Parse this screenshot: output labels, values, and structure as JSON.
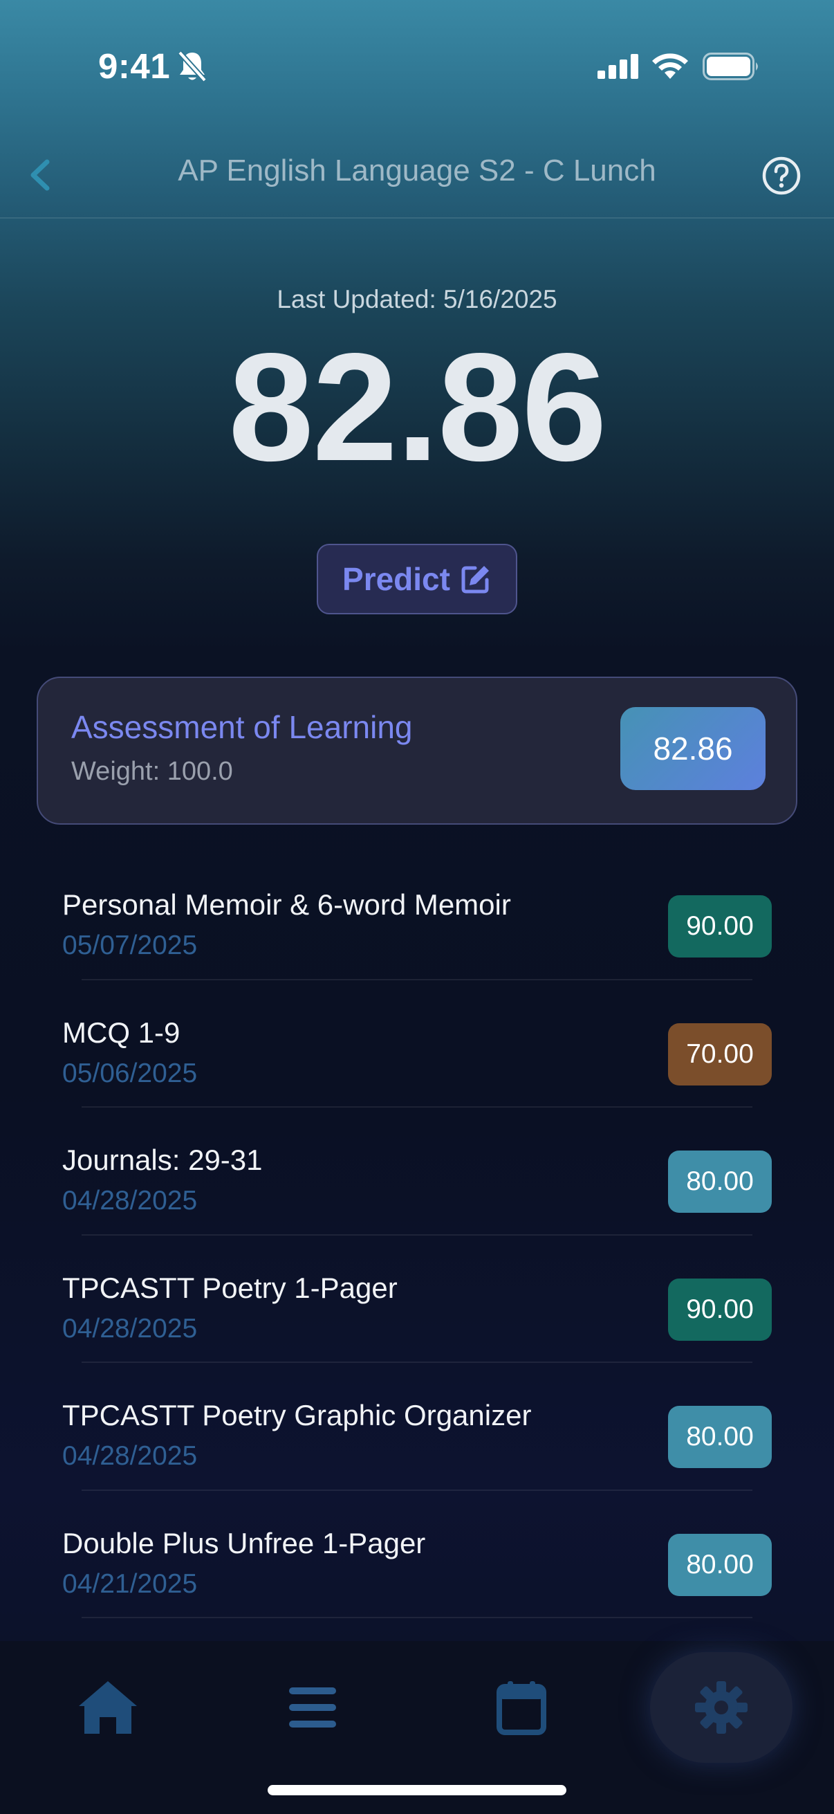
{
  "status_bar": {
    "time": "9:41"
  },
  "nav": {
    "title": "AP English Language S2 - C Lunch"
  },
  "summary": {
    "last_updated": "Last Updated: 5/16/2025",
    "overall_grade": "82.86",
    "predict_label": "Predict"
  },
  "category": {
    "name": "Assessment of Learning",
    "weight": "Weight: 100.0",
    "score": "82.86"
  },
  "assignments": [
    {
      "title": "Personal Memoir & 6-word Memoir",
      "date": "05/07/2025",
      "score": "90.00",
      "color": "#13695f"
    },
    {
      "title": "MCQ 1-9",
      "date": "05/06/2025",
      "score": "70.00",
      "color": "#7b4e2b"
    },
    {
      "title": "Journals: 29-31",
      "date": "04/28/2025",
      "score": "80.00",
      "color": "#3f8ea8"
    },
    {
      "title": "TPCASTT Poetry 1-Pager",
      "date": "04/28/2025",
      "score": "90.00",
      "color": "#13695f"
    },
    {
      "title": "TPCASTT Poetry Graphic Organizer",
      "date": "04/28/2025",
      "score": "80.00",
      "color": "#3f8ea8"
    },
    {
      "title": "Double Plus Unfree 1-Pager",
      "date": "04/21/2025",
      "score": "80.00",
      "color": "#3f8ea8"
    }
  ],
  "tabs": [
    {
      "icon": "home-icon"
    },
    {
      "icon": "list-icon"
    },
    {
      "icon": "calendar-icon"
    },
    {
      "icon": "gear-icon",
      "selected": true
    }
  ],
  "colors": {
    "accent": "#7b88f0",
    "tab_icon": "#1f4d7a"
  }
}
